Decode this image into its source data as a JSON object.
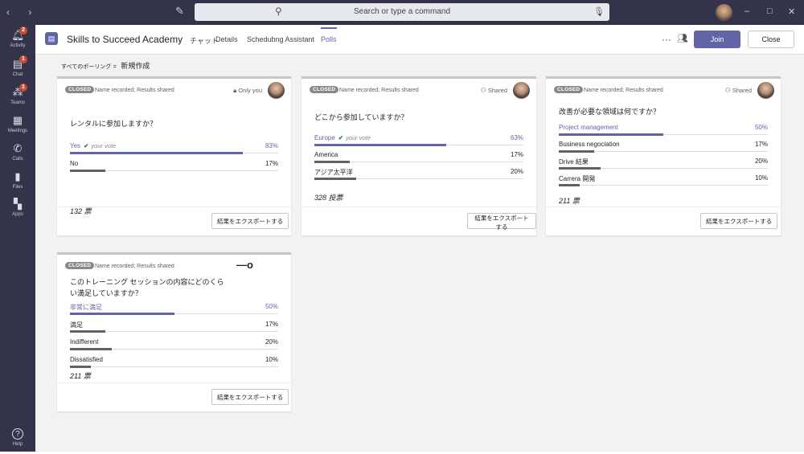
{
  "titlebar": {
    "search_placeholder": "Search or type a command",
    "win_min": "–",
    "win_max": "□",
    "win_close": "✕"
  },
  "rail": [
    {
      "label": "Activity",
      "icon": "bell-icon",
      "badge": "2"
    },
    {
      "label": "Chat",
      "icon": "chat-icon",
      "badge": "1"
    },
    {
      "label": "Teams",
      "icon": "teams-icon",
      "badge": "1"
    },
    {
      "label": "Meetings",
      "icon": "calendar-icon",
      "badge": ""
    },
    {
      "label": "Calls",
      "icon": "phone-icon",
      "badge": ""
    },
    {
      "label": "Files",
      "icon": "files-icon",
      "badge": ""
    },
    {
      "label": "Apps",
      "icon": "apps-icon",
      "badge": ""
    },
    {
      "label": "Help",
      "icon": "help-icon",
      "badge": ""
    }
  ],
  "header": {
    "team_name": "Skills to Succeed Academy",
    "tabs": [
      "チャット",
      "Details",
      "Schedubng Assistant",
      "Polls"
    ],
    "join_label": "Join",
    "close_label": "Close",
    "more": "···"
  },
  "breadcrumb": {
    "all": "すべてのポーリング",
    "sep": "=",
    "new": "新規作成"
  },
  "colors": {
    "accent": "#6264a7",
    "rail": "#33344a",
    "bar": "#616161"
  },
  "polls": [
    {
      "status": "CLOSED",
      "recorded": "Name recorded; Results shared",
      "visibility": "Only you",
      "question": "レンタルに参加しますか？",
      "options": [
        {
          "label": "Yes",
          "your_vote": "your vote",
          "percent": "83%",
          "value": 0.83,
          "voted": true
        },
        {
          "label": "No",
          "your_vote": "",
          "percent": "17%",
          "value": 0.17,
          "voted": false
        }
      ],
      "total": "132 票",
      "export": "結果をエクスポートする"
    },
    {
      "status": "CLOSED",
      "recorded": "Name recorded; Results shared",
      "visibility": "Shared",
      "question": "どこから参加していますか？",
      "options": [
        {
          "label": "Europe",
          "your_vote": "your vote",
          "percent": "63%",
          "value": 0.63,
          "voted": true
        },
        {
          "label": "America",
          "your_vote": "",
          "percent": "17%",
          "value": 0.17,
          "voted": false
        },
        {
          "label": "アジア太平洋",
          "your_vote": "",
          "percent": "20%",
          "value": 0.2,
          "voted": false
        }
      ],
      "total": "328 投票",
      "export": "結果をエクスポートする"
    },
    {
      "status": "CLOSED",
      "recorded": "Name recorded; Results shared",
      "visibility": "Shared",
      "question": "改善が必要な領域は何ですか？",
      "options": [
        {
          "label": "Project management",
          "your_vote": "",
          "percent": "50%",
          "value": 0.5,
          "voted": true
        },
        {
          "label": "Business negociation",
          "your_vote": "",
          "percent": "17%",
          "value": 0.17,
          "voted": false
        },
        {
          "label": "Drive 結果",
          "your_vote": "",
          "percent": "20%",
          "value": 0.2,
          "voted": false
        },
        {
          "label": "Carrera 開発",
          "your_vote": "",
          "percent": "10%",
          "value": 0.1,
          "voted": false
        }
      ],
      "total": "211 票",
      "export": "結果をエクスポートする"
    },
    {
      "status": "CLOSED",
      "recorded": "Name recorded; Results shared",
      "visibility": "",
      "question": "このトレーニング セッションの内容にどのくらい満足していますか？",
      "options": [
        {
          "label": "非常に満足",
          "your_vote": "",
          "percent": "50%",
          "value": 0.5,
          "voted": true
        },
        {
          "label": "満足",
          "your_vote": "",
          "percent": "17%",
          "value": 0.17,
          "voted": false
        },
        {
          "label": "Indifferent",
          "your_vote": "",
          "percent": "20%",
          "value": 0.2,
          "voted": false
        },
        {
          "label": "Dissatisfied",
          "your_vote": "",
          "percent": "10%",
          "value": 0.1,
          "voted": false
        }
      ],
      "total": "211 票",
      "export": "結果をエクスポートする",
      "extra_mark": "—o"
    }
  ]
}
